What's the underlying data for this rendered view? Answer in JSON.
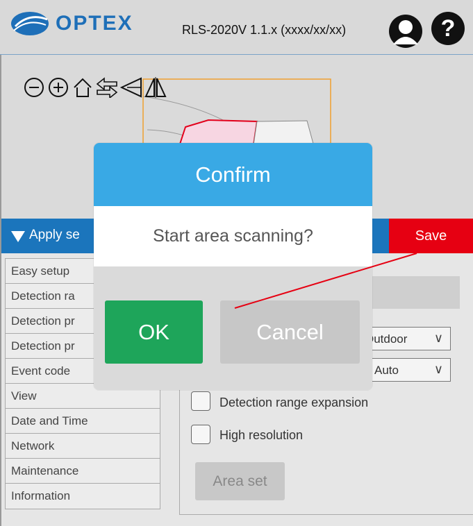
{
  "header": {
    "brand": "OPTEX",
    "version": "RLS-2020V 1.1.x (xxxx/xx/xx)",
    "user_icon": "user-icon",
    "help_icon": "help-icon"
  },
  "map_tools": [
    {
      "name": "zoom-out-icon",
      "glyph": "minus-circle"
    },
    {
      "name": "zoom-in-icon",
      "glyph": "plus-circle"
    },
    {
      "name": "home-icon",
      "glyph": "house"
    },
    {
      "name": "swap-icon",
      "glyph": "arrows"
    },
    {
      "name": "flip-vertical-icon",
      "glyph": "triangle"
    },
    {
      "name": "flip-horizontal-icon",
      "glyph": "mirror"
    }
  ],
  "apply_bar": {
    "label": "Apply se",
    "save_label": "Save"
  },
  "menu": {
    "items": [
      "Easy setup",
      "Detection ra",
      "Detection pr",
      "Detection pr",
      "Event code",
      "View",
      "Date and Time",
      "Network",
      "Maintenance",
      "Information"
    ]
  },
  "content": {
    "select_environment": "Outdoor",
    "select_mode": "Auto",
    "checkbox_expansion_label": "Detection range expansion",
    "checkbox_resolution_label": "High resolution",
    "area_set_label": "Area set"
  },
  "modal": {
    "title": "Confirm",
    "message": "Start area scanning?",
    "ok_label": "OK",
    "cancel_label": "Cancel"
  },
  "colors": {
    "brand_blue": "#1e6fb8",
    "apply_bar": "#1b75bc",
    "save_red": "#e60012",
    "modal_header": "#39a9e5",
    "ok_green": "#1ea55a"
  }
}
